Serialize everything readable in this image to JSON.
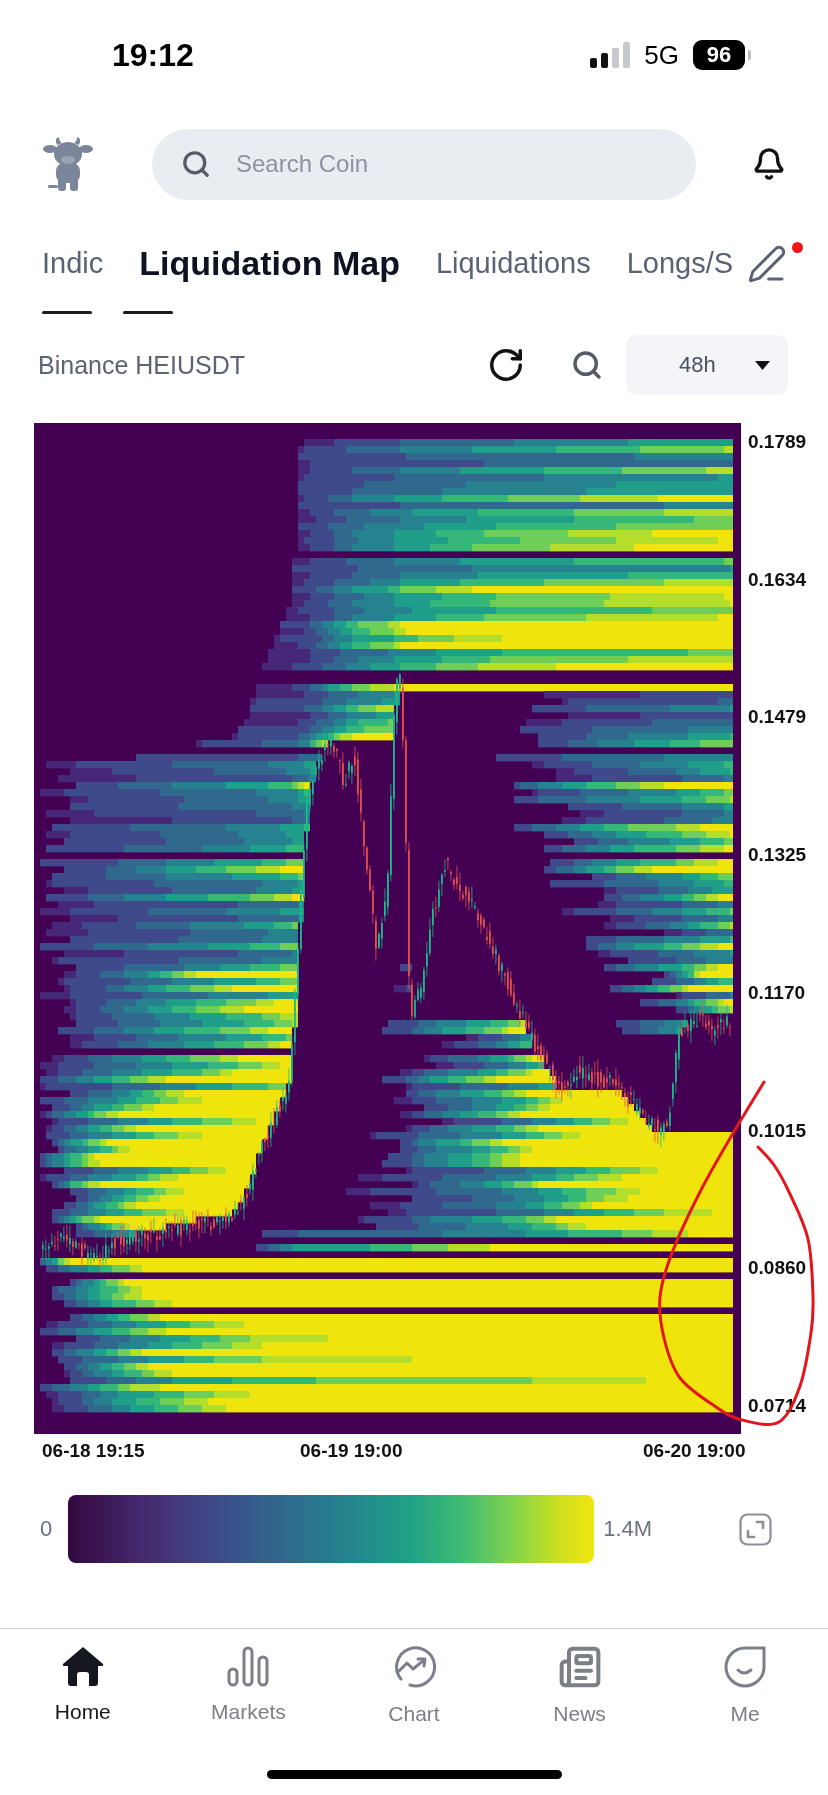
{
  "status_bar": {
    "time": "19:12",
    "network": "5G",
    "battery": "96"
  },
  "search": {
    "placeholder": "Search Coin"
  },
  "tabs": [
    {
      "label": "Indic",
      "selected": false
    },
    {
      "label": "Liquidation Map",
      "selected": true
    },
    {
      "label": "Liquidations",
      "selected": false
    },
    {
      "label": "Longs/S",
      "selected": false
    }
  ],
  "edit_button": {
    "badge": true
  },
  "toolbar": {
    "pair": "Binance HEIUSDT",
    "range": "48h"
  },
  "chart": {
    "price_axis": [
      "0.1789",
      "0.1634",
      "0.1479",
      "0.1325",
      "0.1170",
      "0.1015",
      "0.0860",
      "0.0714"
    ],
    "time_axis": [
      "06-18 19:15",
      "06-19 19:00",
      "06-20 19:00"
    ],
    "annotations": [
      {
        "kind": "loop"
      }
    ]
  },
  "legend": {
    "min": "0",
    "max": "1.4M"
  },
  "nav": [
    {
      "label": "Home",
      "selected": true
    },
    {
      "label": "Markets",
      "selected": false
    },
    {
      "label": "Chart",
      "selected": false
    },
    {
      "label": "News",
      "selected": false
    },
    {
      "label": "Me",
      "selected": false
    }
  ]
}
